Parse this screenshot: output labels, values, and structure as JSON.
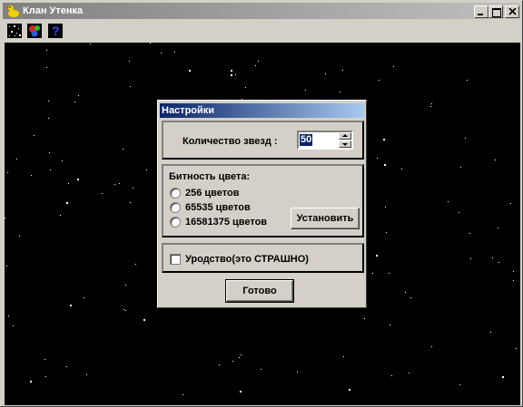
{
  "window": {
    "title": "Клан Утенка"
  },
  "toolbar": {
    "icons": [
      "stars-icon",
      "colors-icon",
      "help-icon"
    ]
  },
  "dialog": {
    "title": "Настройки",
    "stars_label": "Количество звезд :",
    "stars_value": "50",
    "color_depth_label": "Битность цвета:",
    "options": [
      "256 цветов",
      "65535 цветов",
      "16581375 цветов"
    ],
    "set_button": "Установить",
    "ugly_label": "Уродство(это СТРАШНО)",
    "done_button": "Готово"
  },
  "colors": {
    "field": "#000000",
    "dialog_title": "#0a246a"
  }
}
